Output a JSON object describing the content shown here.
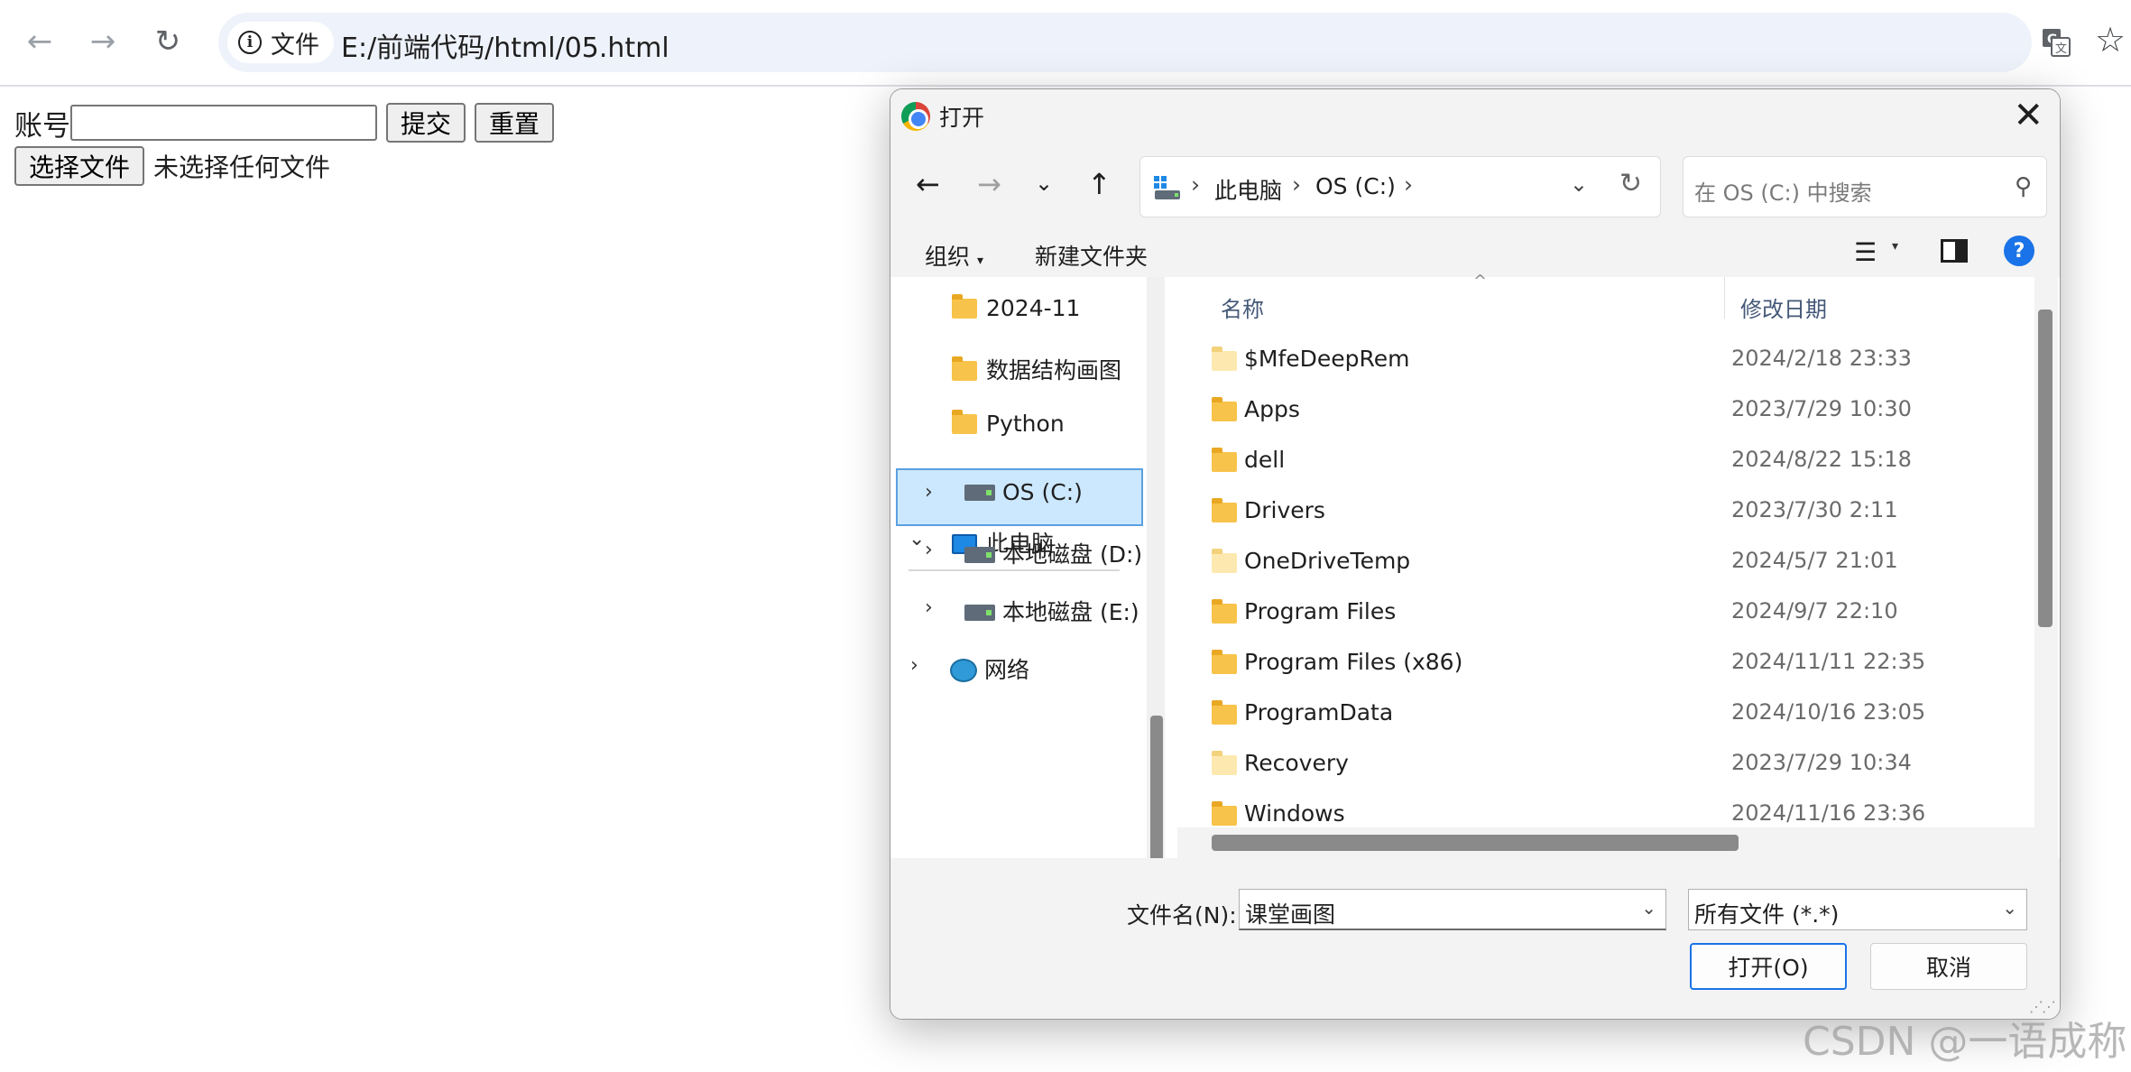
{
  "browser": {
    "site_chip": "文件",
    "url": "E:/前端代码/html/05.html"
  },
  "page": {
    "account_label": "账号",
    "account_value": "",
    "submit_label": "提交",
    "reset_label": "重置",
    "choose_file_label": "选择文件",
    "no_file_text": "未选择任何文件"
  },
  "dialog": {
    "title": "打开",
    "breadcrumb": [
      "此电脑",
      "OS (C:)"
    ],
    "search_placeholder": "在 OS (C:) 中搜索",
    "organize_label": "组织",
    "new_folder_label": "新建文件夹",
    "help": "?",
    "nav": {
      "folders": [
        "2024-11",
        "数据结构画图",
        "Python"
      ],
      "this_pc": "此电脑",
      "drives": [
        "OS (C:)",
        "本地磁盘 (D:)",
        "本地磁盘 (E:)"
      ],
      "network": "网络"
    },
    "columns": {
      "name": "名称",
      "date": "修改日期"
    },
    "files": [
      {
        "name": "$MfeDeepRem",
        "date": "2024/2/18 23:33",
        "pale": true
      },
      {
        "name": "Apps",
        "date": "2023/7/29 10:30",
        "pale": false
      },
      {
        "name": "dell",
        "date": "2024/8/22 15:18",
        "pale": false
      },
      {
        "name": "Drivers",
        "date": "2023/7/30 2:11",
        "pale": false
      },
      {
        "name": "OneDriveTemp",
        "date": "2024/5/7 21:01",
        "pale": true
      },
      {
        "name": "Program Files",
        "date": "2024/9/7 22:10",
        "pale": false
      },
      {
        "name": "Program Files (x86)",
        "date": "2024/11/11 22:35",
        "pale": false
      },
      {
        "name": "ProgramData",
        "date": "2024/10/16 23:05",
        "pale": false
      },
      {
        "name": "Recovery",
        "date": "2023/7/29 10:34",
        "pale": true
      },
      {
        "name": "Windows",
        "date": "2024/11/16 23:36",
        "pale": false
      }
    ],
    "filename_label": "文件名(N):",
    "filename_value": "课堂画图",
    "filetype_value": "所有文件 (*.*)",
    "open_label": "打开(O)",
    "cancel_label": "取消"
  },
  "watermark": "CSDN @一语成称"
}
